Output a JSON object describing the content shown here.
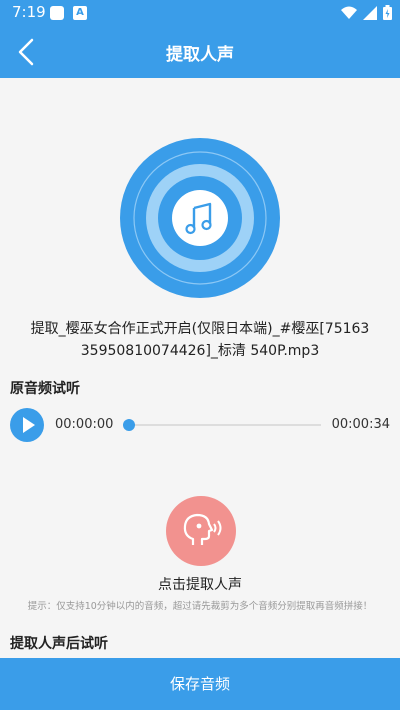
{
  "status_bar": {
    "time": "7:19",
    "icons": [
      "notification-square-icon",
      "a-notification-icon",
      "wifi-icon",
      "signal-icon",
      "battery-icon"
    ]
  },
  "header": {
    "title": "提取人声",
    "back_icon": "chevron-left-icon"
  },
  "disc": {
    "icon": "music-note-icon",
    "colors": {
      "outer": "#3a9de9",
      "ring": "#8cc8f5",
      "center": "#ffffff",
      "note": "#3a9de9"
    }
  },
  "file": {
    "name": "提取_樱巫女合作正式开启(仅限日本端)_#樱巫[7516335950810074426]_标清 540P.mp3"
  },
  "original": {
    "section_title": "原音频试听",
    "current_time": "00:00:00",
    "total_time": "00:00:34",
    "progress": 0
  },
  "extract": {
    "icon": "voice-extract-icon",
    "label": "点击提取人声",
    "tip": "提示：仅支持10分钟以内的音频，超过请先裁剪为多个音频分别提取再音频拼接！"
  },
  "extracted": {
    "section_title": "提取人声后试听"
  },
  "footer": {
    "save_label": "保存音频"
  },
  "colors": {
    "primary": "#3a9de9",
    "accent": "#f2928f",
    "background": "#f5f5f5"
  }
}
